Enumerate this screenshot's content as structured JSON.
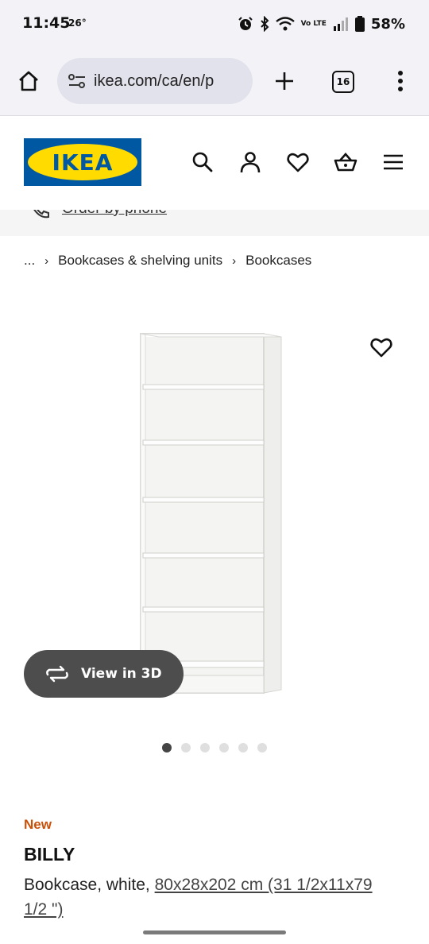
{
  "status_bar": {
    "time": "11:45",
    "temperature": "26°",
    "battery": "58%",
    "network": "Vo LTE",
    "icons": [
      "alarm-icon",
      "bluetooth-icon",
      "wifi-icon",
      "volte-icon",
      "signal-icon",
      "battery-icon"
    ]
  },
  "browser": {
    "url": "ikea.com/ca/en/p",
    "tab_count": "16",
    "icons": [
      "home-icon",
      "tune-icon",
      "plus-icon",
      "tabs-icon",
      "more-vert-icon"
    ]
  },
  "header": {
    "logo_text": "IKEA",
    "icons": [
      "search-icon",
      "user-icon",
      "heart-icon",
      "basket-icon",
      "hamburger-icon"
    ],
    "colors": {
      "logo_blue": "#0058a3",
      "logo_yellow": "#ffdb00"
    }
  },
  "phone_strip": {
    "text": "Order by phone"
  },
  "breadcrumb": {
    "ellipsis": "...",
    "separator": "›",
    "items": [
      "Bookcases & shelving units",
      "Bookcases"
    ]
  },
  "gallery": {
    "view_3d_label": "View in 3D",
    "slide_count": 6,
    "active_slide": 1
  },
  "product": {
    "badge": "New",
    "badge_color": "#ca5008",
    "name": "BILLY",
    "description": "Bookcase, white,",
    "measurement": "80x28x202 cm (31 1/2x11x79 1/2 \")"
  }
}
